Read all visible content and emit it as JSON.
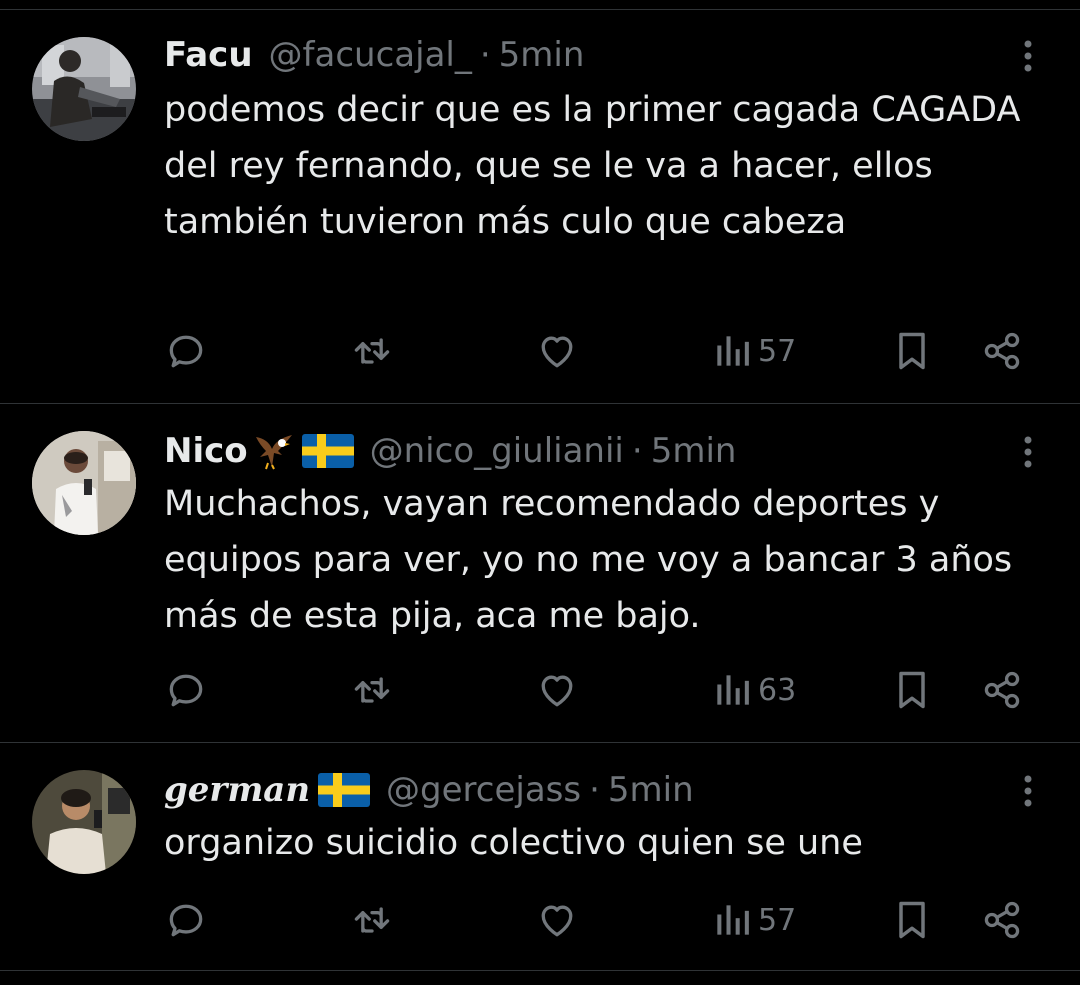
{
  "colors": {
    "background": "#000000",
    "text": "#e7e9ea",
    "muted": "#71767b",
    "divider": "#2f3336"
  },
  "tweets": [
    {
      "name": "Facu",
      "handle": "@facucajal_",
      "dot": "·",
      "time": "5min",
      "text": "podemos decir que es la primer cagada CAGADA del rey fernando, que se le va a hacer, ellos también tuvieron más culo que cabeza",
      "views": "57",
      "avatar_icon": "avatar-photo",
      "flag_icon": "",
      "emoji_icon": ""
    },
    {
      "name": "Nico",
      "handle": "@nico_giulianii",
      "dot": "·",
      "time": "5min",
      "text": "Muchachos, vayan recomendado deportes y equipos para ver, yo no me voy a bancar 3 años más de esta pija, aca me bajo.",
      "views": "63",
      "avatar_icon": "avatar-photo",
      "flag_icon": "sweden-flag-icon",
      "emoji_icon": "eagle-icon"
    },
    {
      "name": "german",
      "handle": "@gercejass",
      "dot": "·",
      "time": "5min",
      "text": "organizo suicidio colectivo quien se une",
      "views": "57",
      "avatar_icon": "avatar-photo",
      "flag_icon": "sweden-flag-icon",
      "emoji_icon": ""
    }
  ],
  "actions": [
    "reply-icon",
    "retweet-icon",
    "like-icon",
    "views-icon",
    "bookmark-icon",
    "share-icon"
  ]
}
